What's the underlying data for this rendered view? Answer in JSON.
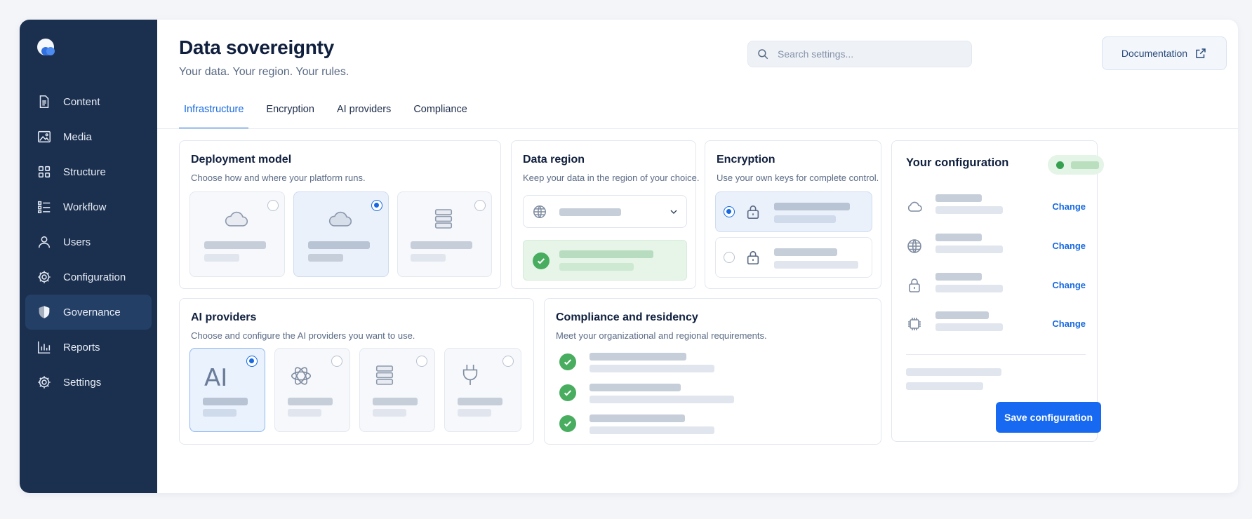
{
  "page": {
    "title": "Data sovereignty",
    "subtitle": "Your data. Your region. Your rules."
  },
  "search": {
    "placeholder": "Search settings..."
  },
  "header": {
    "documentation_label": "Documentation"
  },
  "sidebar": {
    "items": [
      {
        "label": "Content",
        "icon": "document-icon",
        "active": false
      },
      {
        "label": "Media",
        "icon": "image-icon",
        "active": false
      },
      {
        "label": "Structure",
        "icon": "structure-icon",
        "active": false
      },
      {
        "label": "Workflow",
        "icon": "workflow-icon",
        "active": false
      },
      {
        "label": "Users",
        "icon": "user-icon",
        "active": false
      },
      {
        "label": "Configuration",
        "icon": "gear-icon",
        "active": false
      },
      {
        "label": "Governance",
        "icon": "shield-icon",
        "active": true
      },
      {
        "label": "Reports",
        "icon": "bar-chart-icon",
        "active": false
      },
      {
        "label": "Settings",
        "icon": "gear-icon",
        "active": false
      }
    ]
  },
  "tabs": [
    {
      "label": "Infrastructure",
      "active": true
    },
    {
      "label": "Encryption",
      "active": false
    },
    {
      "label": "AI providers",
      "active": false
    },
    {
      "label": "Compliance",
      "active": false
    }
  ],
  "deployment": {
    "title": "Deployment model",
    "description": "Choose how and where your platform runs.",
    "options": [
      {
        "icon": "cloud-icon",
        "selected": false
      },
      {
        "icon": "cloud-icon",
        "selected": true
      },
      {
        "icon": "server-icon",
        "selected": false
      }
    ]
  },
  "region": {
    "title": "Data region",
    "description": "Keep your data in the region of your choice."
  },
  "encryption": {
    "title": "Encryption",
    "description": "Use your own keys for complete control.",
    "options": [
      {
        "icon": "lock-icon",
        "selected": true
      },
      {
        "icon": "lock-icon",
        "selected": false
      }
    ]
  },
  "ai_providers": {
    "title": "AI providers",
    "description": "Choose and configure the AI providers you want to use.",
    "options": [
      {
        "icon": "ai-text-icon",
        "glyph": "AI",
        "selected": true
      },
      {
        "icon": "openai-icon",
        "selected": false
      },
      {
        "icon": "server-icon",
        "selected": false
      },
      {
        "icon": "plug-icon",
        "selected": false
      }
    ]
  },
  "compliance": {
    "title": "Compliance and residency",
    "description": "Meet your organizational and regional requirements.",
    "items": 3
  },
  "configuration": {
    "title": "Your configuration",
    "rows": [
      {
        "icon": "cloud-icon",
        "action": "Change"
      },
      {
        "icon": "globe-icon",
        "action": "Change"
      },
      {
        "icon": "lock-icon",
        "action": "Change"
      },
      {
        "icon": "chip-icon",
        "action": "Change"
      }
    ],
    "save_label": "Save configuration"
  },
  "colors": {
    "sidebar_bg": "#1b2f4e",
    "accent": "#1669e0",
    "success": "#49ad60"
  }
}
